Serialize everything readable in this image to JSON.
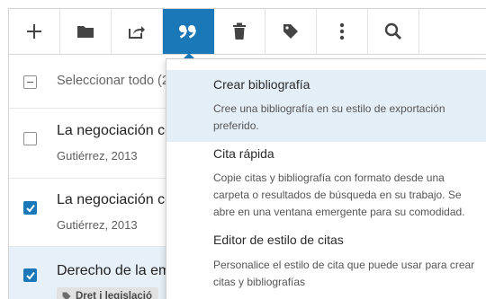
{
  "toolbar": {
    "buttons": [
      {
        "icon": "plus-icon"
      },
      {
        "icon": "folder-icon"
      },
      {
        "icon": "share-icon"
      },
      {
        "icon": "quote-icon",
        "active": true
      },
      {
        "icon": "trash-icon"
      },
      {
        "icon": "tag-icon"
      },
      {
        "icon": "more-vertical-icon"
      },
      {
        "icon": "search-icon"
      }
    ],
    "accent_color": "#1a78b8"
  },
  "list": {
    "select_all_label": "Seleccionar todo (2",
    "items": [
      {
        "title": "La negociación co",
        "subtitle": "Gutiérrez, 2013",
        "checked": false
      },
      {
        "title": "La negociación co",
        "subtitle": "Gutiérrez, 2013",
        "checked": true
      },
      {
        "title": "Derecho de la emp",
        "tag": "Dret i legislació",
        "checked": true
      }
    ]
  },
  "citation_menu": {
    "items": [
      {
        "title": "Crear bibliografía",
        "description": "Cree una bibliografía en su estilo de exportación preferido."
      },
      {
        "title": "Cita rápida",
        "description": "Copie citas y bibliografía con formato desde una carpeta o resultados de búsqueda en su trabajo. Se abre en una ventana emergente para su comodidad."
      },
      {
        "title": "Editor de estilo de citas",
        "description": "Personalice el estilo de cita que puede usar para crear citas y bibliografías"
      }
    ]
  }
}
